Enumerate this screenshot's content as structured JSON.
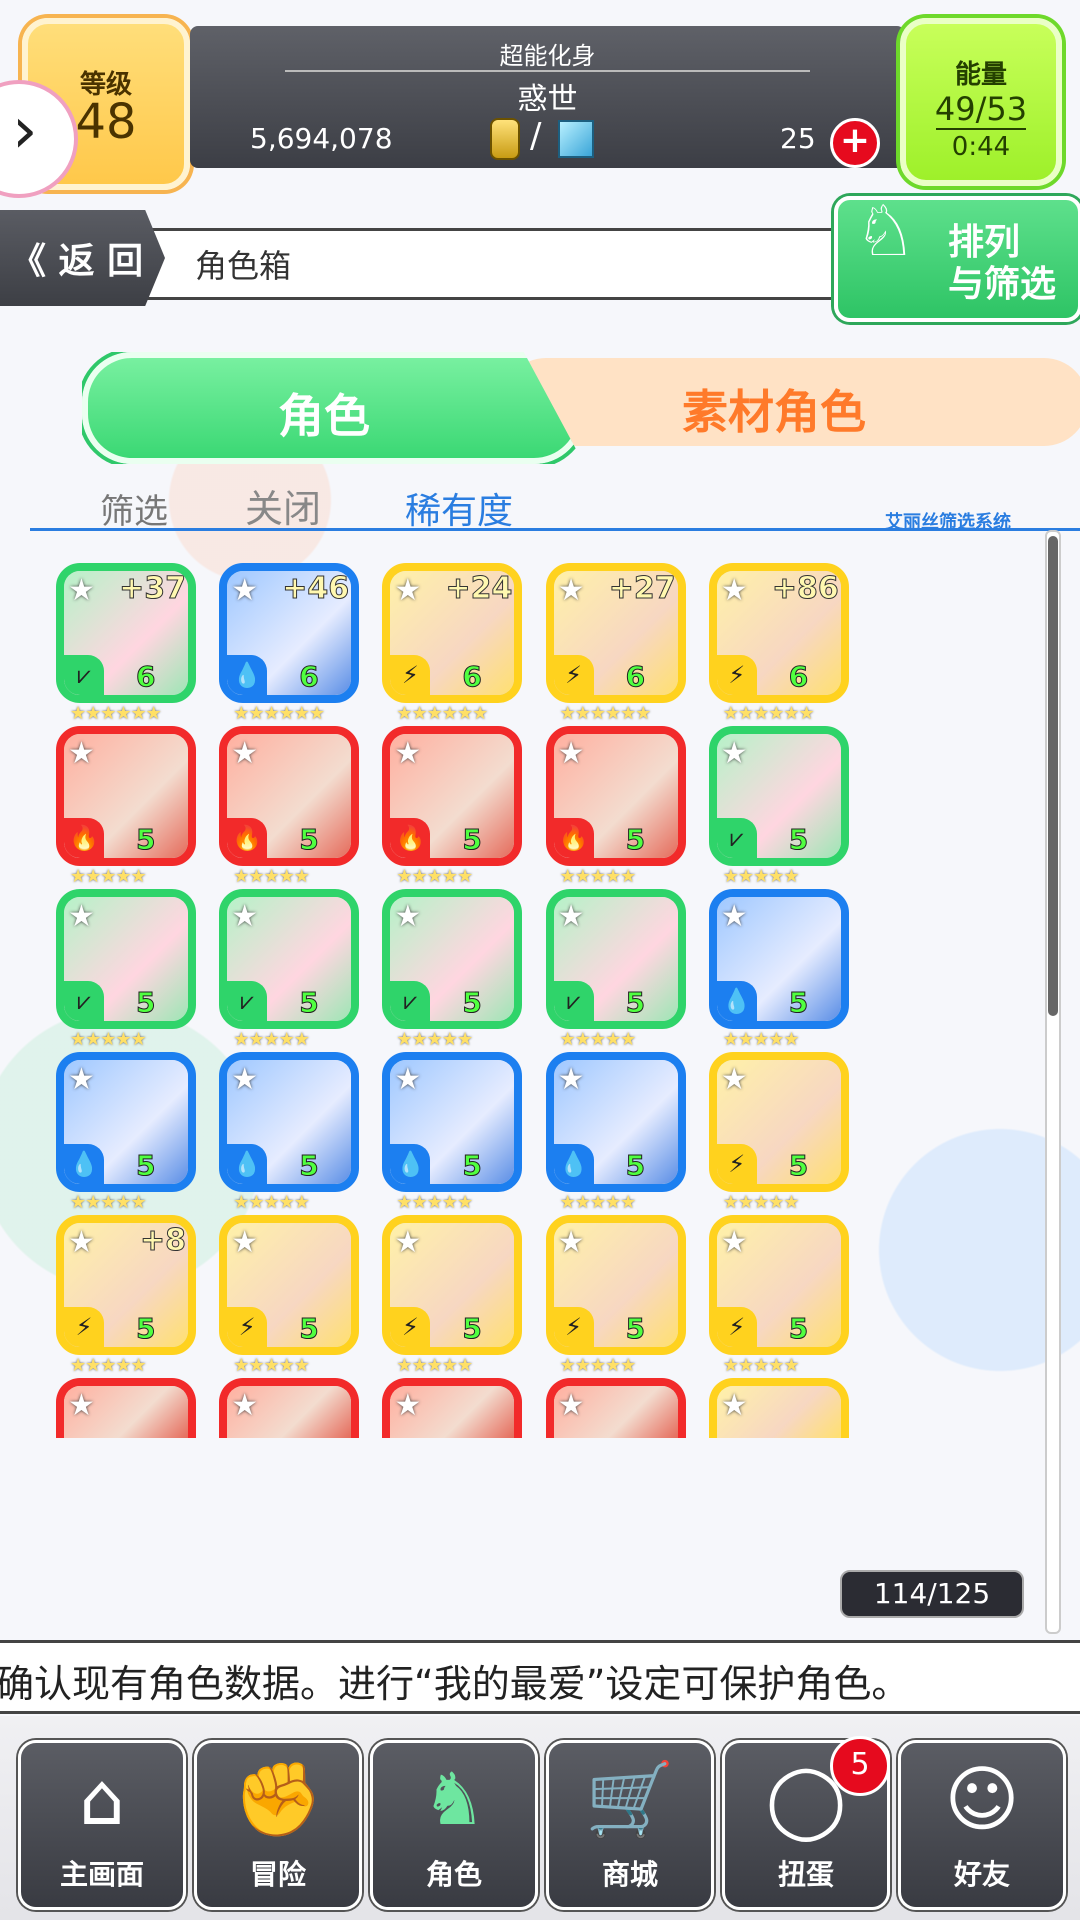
{
  "header": {
    "level_label": "等级",
    "level_value": "48",
    "subtitle": "超能化身",
    "player_name": "惑世",
    "coins": "5,694,078",
    "slash": "/",
    "gems": "25",
    "plus_label": "+",
    "energy_label": "能量",
    "energy_value": "49/53",
    "energy_timer": "0:44"
  },
  "nav_bar": {
    "back_label": "《 返 回",
    "page_title": "角色箱",
    "sort_label_1": "排列",
    "sort_label_2": "与筛选"
  },
  "tabs": {
    "left": "角色",
    "right": "素材角色"
  },
  "filter": {
    "label": "筛选",
    "state": "关闭",
    "sort": "稀有度",
    "system": "艾丽丝筛选系统"
  },
  "colors": {
    "green": "#2fd46a",
    "blue": "#1c7ff0",
    "yellow": "#ffd21e",
    "red": "#f22a2a",
    "accent_green": "#3bd874"
  },
  "cards": [
    {
      "color": "green",
      "element": "wind",
      "level": "6",
      "plus": "+37",
      "stars": 6
    },
    {
      "color": "blue",
      "element": "water",
      "level": "6",
      "plus": "+46",
      "stars": 6
    },
    {
      "color": "yellow",
      "element": "thunder",
      "level": "6",
      "plus": "+24",
      "stars": 6
    },
    {
      "color": "yellow",
      "element": "thunder",
      "level": "6",
      "plus": "+27",
      "stars": 6
    },
    {
      "color": "yellow",
      "element": "thunder",
      "level": "6",
      "plus": "+86",
      "stars": 6
    },
    {
      "color": "red",
      "element": "fire",
      "level": "5",
      "plus": "",
      "stars": 5
    },
    {
      "color": "red",
      "element": "fire",
      "level": "5",
      "plus": "",
      "stars": 5
    },
    {
      "color": "red",
      "element": "fire",
      "level": "5",
      "plus": "",
      "stars": 5
    },
    {
      "color": "red",
      "element": "fire",
      "level": "5",
      "plus": "",
      "stars": 5
    },
    {
      "color": "green",
      "element": "wind",
      "level": "5",
      "plus": "",
      "stars": 5
    },
    {
      "color": "green",
      "element": "wind",
      "level": "5",
      "plus": "",
      "stars": 5
    },
    {
      "color": "green",
      "element": "wind",
      "level": "5",
      "plus": "",
      "stars": 5
    },
    {
      "color": "green",
      "element": "wind",
      "level": "5",
      "plus": "",
      "stars": 5
    },
    {
      "color": "green",
      "element": "wind",
      "level": "5",
      "plus": "",
      "stars": 5
    },
    {
      "color": "blue",
      "element": "water",
      "level": "5",
      "plus": "",
      "stars": 5
    },
    {
      "color": "blue",
      "element": "water",
      "level": "5",
      "plus": "",
      "stars": 5
    },
    {
      "color": "blue",
      "element": "water",
      "level": "5",
      "plus": "",
      "stars": 5
    },
    {
      "color": "blue",
      "element": "water",
      "level": "5",
      "plus": "",
      "stars": 5
    },
    {
      "color": "blue",
      "element": "water",
      "level": "5",
      "plus": "",
      "stars": 5
    },
    {
      "color": "yellow",
      "element": "thunder",
      "level": "5",
      "plus": "",
      "stars": 5
    },
    {
      "color": "yellow",
      "element": "thunder",
      "level": "5",
      "plus": "+8",
      "stars": 5
    },
    {
      "color": "yellow",
      "element": "thunder",
      "level": "5",
      "plus": "",
      "stars": 5
    },
    {
      "color": "yellow",
      "element": "thunder",
      "level": "5",
      "plus": "",
      "stars": 5
    },
    {
      "color": "yellow",
      "element": "thunder",
      "level": "5",
      "plus": "",
      "stars": 5
    },
    {
      "color": "yellow",
      "element": "thunder",
      "level": "5",
      "plus": "",
      "stars": 5
    }
  ],
  "partial_row_colors": [
    "red",
    "red",
    "red",
    "red",
    "yellow"
  ],
  "box_count": "114/125",
  "marquee": "确认现有角色数据。进行“我的最爱”设定可保护角色。",
  "bottom_nav": [
    {
      "label": "主画面",
      "icon": "home-icon",
      "glyph": "⌂"
    },
    {
      "label": "冒险",
      "icon": "fist-icon",
      "glyph": "✊"
    },
    {
      "label": "角色",
      "icon": "rabbit-icon",
      "glyph": "♞",
      "active": true
    },
    {
      "label": "商城",
      "icon": "cart-icon",
      "glyph": "🛒"
    },
    {
      "label": "扭蛋",
      "icon": "egg-icon",
      "glyph": "◯"
    },
    {
      "label": "好友",
      "icon": "friends-icon",
      "glyph": "☺"
    }
  ],
  "gacha_badge": "5"
}
